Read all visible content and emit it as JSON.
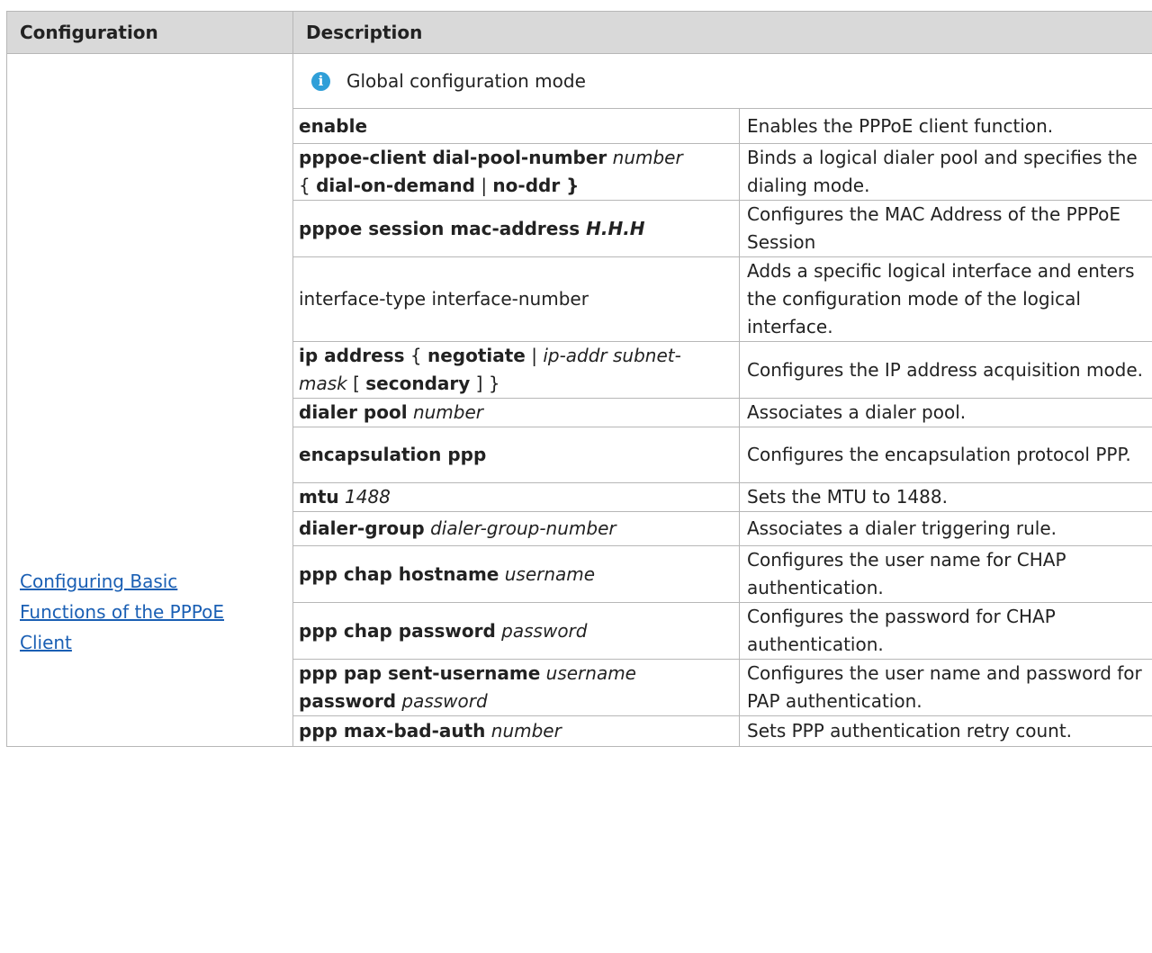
{
  "headers": {
    "configuration": "Configuration",
    "description": "Description"
  },
  "config_link": [
    "Configuring Basic ",
    "Functions of the PPPoE ",
    "Client"
  ],
  "mode_label": "Global configuration mode",
  "rows": [
    {
      "cmd": [
        [
          "b",
          "enable"
        ]
      ],
      "desc": "Enables the PPPoE client function."
    },
    {
      "cmd": [
        [
          "b",
          "pppoe-client dial-pool-number"
        ],
        [
          "t",
          " "
        ],
        [
          "i",
          "number"
        ],
        [
          "br",
          ""
        ],
        [
          "t",
          "{ "
        ],
        [
          "b",
          "dial-on-demand"
        ],
        [
          "t",
          " | "
        ],
        [
          "b",
          "no-ddr }"
        ]
      ],
      "desc": "Binds a logical dialer pool and specifies the dialing mode."
    },
    {
      "cmd": [
        [
          "b",
          "pppoe session mac-address "
        ],
        [
          "bi",
          "H.H.H"
        ]
      ],
      "desc": "Configures the MAC Address of the PPPoE Session"
    },
    {
      "cmd": [
        [
          "t",
          "interface-type interface-number"
        ]
      ],
      "desc": "Adds a specific logical interface and enters the configuration mode of the logical interface."
    },
    {
      "cmd": [
        [
          "b",
          "ip address"
        ],
        [
          "t",
          " { "
        ],
        [
          "b",
          "negotiate"
        ],
        [
          "t",
          " | "
        ],
        [
          "i",
          "ip-addr subnet-"
        ],
        [
          "br",
          ""
        ],
        [
          "i",
          "mask"
        ],
        [
          "t",
          " [ "
        ],
        [
          "b",
          "secondary"
        ],
        [
          "t",
          " ] }"
        ]
      ],
      "desc": "Configures the IP address acquisition mode."
    },
    {
      "cmd": [
        [
          "b",
          "dialer pool"
        ],
        [
          "t",
          " "
        ],
        [
          "i",
          "number"
        ]
      ],
      "desc": "Associates a dialer pool."
    },
    {
      "cmd": [
        [
          "b",
          "encapsulation ppp"
        ]
      ],
      "desc": "Configures the encapsulation protocol PPP."
    },
    {
      "cmd": [
        [
          "b",
          "mtu"
        ],
        [
          "t",
          " "
        ],
        [
          "i",
          "1488"
        ]
      ],
      "desc": "Sets the MTU to 1488."
    },
    {
      "cmd": [
        [
          "b",
          "dialer-group"
        ],
        [
          "t",
          " "
        ],
        [
          "i",
          "dialer-group-number"
        ]
      ],
      "desc": "Associates a dialer triggering rule."
    },
    {
      "cmd": [
        [
          "b",
          "ppp chap hostname"
        ],
        [
          "t",
          " "
        ],
        [
          "i",
          "username"
        ]
      ],
      "desc": "Configures the user name for CHAP authentication."
    },
    {
      "cmd": [
        [
          "b",
          "ppp chap password"
        ],
        [
          "t",
          " "
        ],
        [
          "i",
          "password"
        ]
      ],
      "desc": "Configures the password for CHAP authentication."
    },
    {
      "cmd": [
        [
          "b",
          "ppp pap sent-username"
        ],
        [
          "t",
          " "
        ],
        [
          "i",
          "username"
        ],
        [
          "br",
          ""
        ],
        [
          "b",
          "password"
        ],
        [
          "t",
          " "
        ],
        [
          "i",
          "password"
        ]
      ],
      "desc": "Configures the user name and password for PAP authentication."
    },
    {
      "cmd": [
        [
          "b",
          "ppp max-bad-auth"
        ],
        [
          "t",
          " "
        ],
        [
          "i",
          "number"
        ]
      ],
      "desc": "Sets PPP authentication retry count."
    }
  ]
}
